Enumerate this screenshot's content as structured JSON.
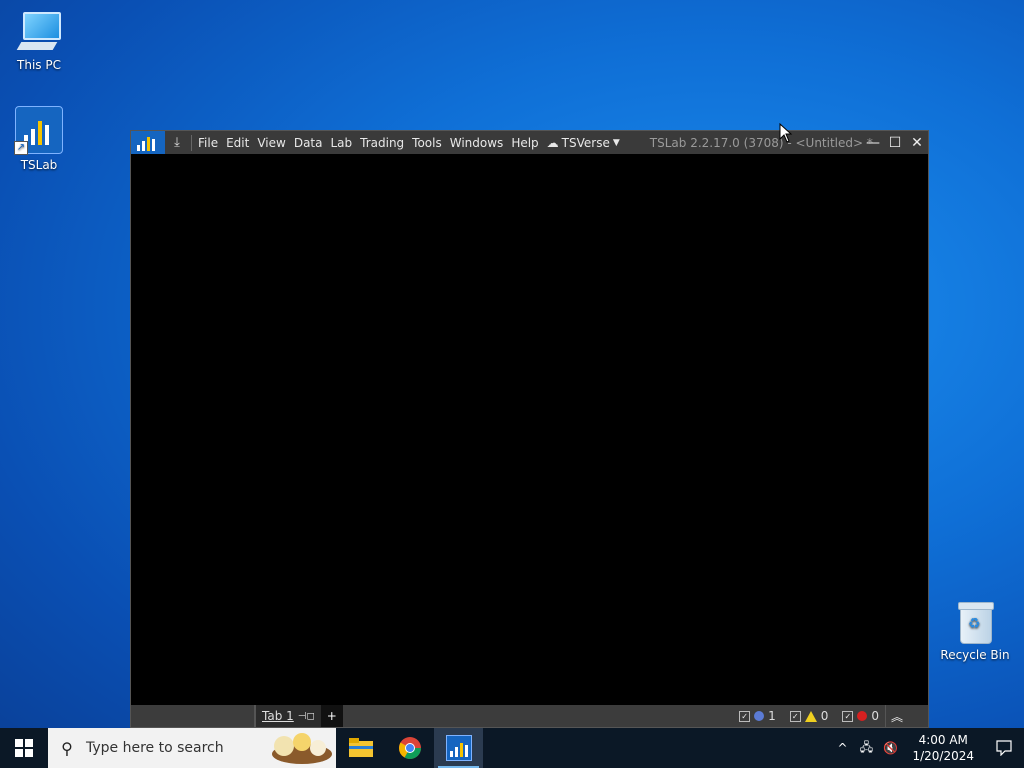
{
  "desktop": {
    "icons": [
      {
        "label": "This PC"
      },
      {
        "label": "TSLab"
      },
      {
        "label": "Recycle Bin"
      }
    ]
  },
  "window": {
    "menu": [
      "File",
      "Edit",
      "View",
      "Data",
      "Lab",
      "Trading",
      "Tools",
      "Windows",
      "Help"
    ],
    "tsverse_label": "TSVerse",
    "title": "TSLab 2.2.17.0 (3708) - <Untitled> *",
    "status": {
      "tab_label": "Tab 1",
      "add_tab": "+",
      "info_count": "1",
      "warning_count": "0",
      "error_count": "0"
    }
  },
  "taskbar": {
    "search_placeholder": "Type here to search",
    "time": "4:00 AM",
    "date": "1/20/2024"
  },
  "colors": {
    "desktop_blue": "#0f6fd6",
    "app_titlebar": "#3a3a3a",
    "tslab_brand": "#1565c0"
  }
}
